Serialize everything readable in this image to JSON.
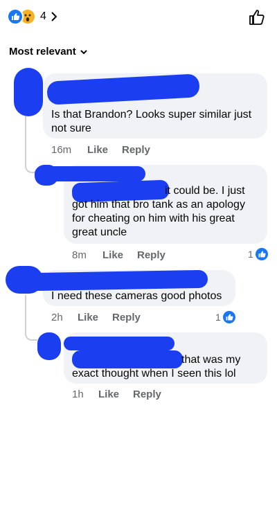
{
  "header": {
    "reaction_count": "4",
    "reaction_icons": [
      "like-icon",
      "wow-icon"
    ]
  },
  "sort": {
    "label": "Most relevant"
  },
  "comments": [
    {
      "text_lines": [
        "Is that Brandon? Looks super similar just",
        "not sure"
      ],
      "time": "16m",
      "like_label": "Like",
      "reply_label": "Reply"
    },
    {
      "text_lines": [
        "it could be. I just",
        "got him that bro tank as an apology",
        "for cheating on him with his great",
        "great uncle"
      ],
      "time": "8m",
      "like_label": "Like",
      "reply_label": "Reply",
      "reaction_count": "1"
    },
    {
      "text_lines": [
        "I need these cameras good photos"
      ],
      "time": "2h",
      "like_label": "Like",
      "reply_label": "Reply",
      "reaction_count": "1"
    },
    {
      "text_lines": [
        "that was my",
        "exact thought when I seen this lol"
      ],
      "time": "1h",
      "like_label": "Like",
      "reply_label": "Reply"
    }
  ],
  "colors": {
    "accent": "#1877f2",
    "bubble": "#f0f2f5",
    "meta": "#65676b",
    "redaction": "#1a3ef0"
  }
}
